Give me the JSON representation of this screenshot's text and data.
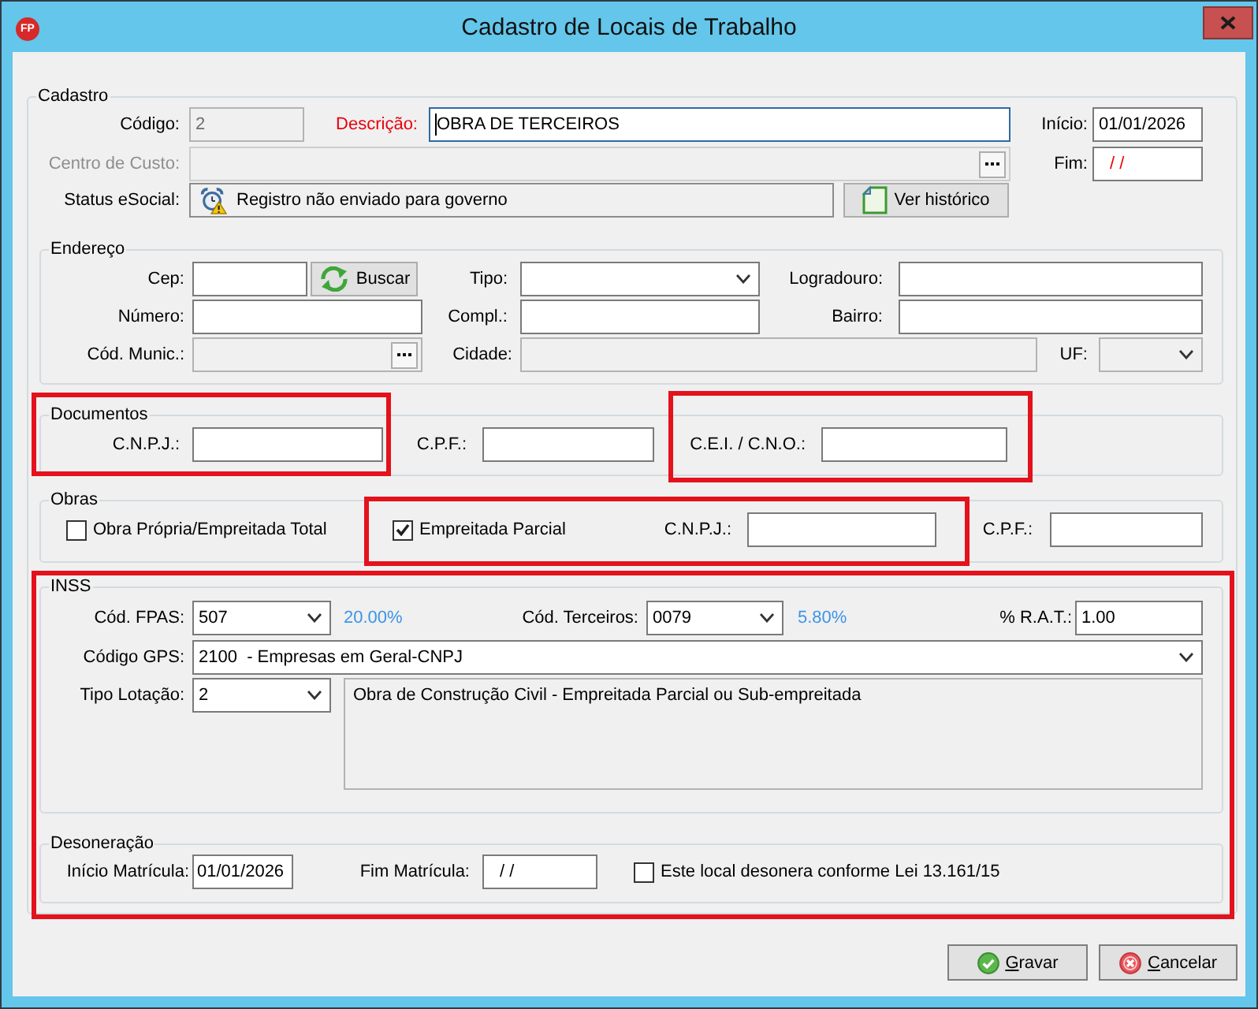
{
  "window": {
    "logo": "FP",
    "title": "Cadastro de Locais de Trabalho"
  },
  "cadastro": {
    "legend": "Cadastro",
    "codigo": {
      "label": "Código:",
      "value": "2",
      "read_only": true
    },
    "descricao": {
      "label": "Descrição:",
      "value": "OBRA DE TERCEIROS",
      "required": true,
      "focused": true
    },
    "inicio": {
      "label": "Início:",
      "value": "01/01/2026"
    },
    "centro_de_custo": {
      "label": "Centro de Custo:",
      "disabled": true
    },
    "fim": {
      "label": "Fim:",
      "value": "/ /",
      "invalid": true
    },
    "status_esocial": {
      "label": "Status eSocial:",
      "value": "Registro não enviado para governo"
    },
    "historico_button": "Ver histórico"
  },
  "endereco": {
    "legend": "Endereço",
    "cep": {
      "label": "Cep:"
    },
    "buscar_button": "Buscar",
    "tipo": {
      "label": "Tipo:"
    },
    "logradouro": {
      "label": "Logradouro:"
    },
    "numero": {
      "label": "Número:"
    },
    "compl": {
      "label": "Compl.:"
    },
    "bairro": {
      "label": "Bairro:"
    },
    "cod_munic": {
      "label": "Cód. Munic.:",
      "read_only": true
    },
    "cidade": {
      "label": "Cidade:",
      "read_only": true
    },
    "uf": {
      "label": "UF:",
      "read_only": true
    }
  },
  "documentos": {
    "legend": "Documentos",
    "cnpj": {
      "label": "C.N.P.J.:"
    },
    "cpf": {
      "label": "C.P.F.:"
    },
    "cei_cno": {
      "label": "C.E.I. / C.N.O.:"
    }
  },
  "obras": {
    "legend": "Obras",
    "options": [
      {
        "label": "Obra Própria/Empreitada Total",
        "checked": false
      },
      {
        "label": "Empreitada Parcial",
        "checked": true
      }
    ],
    "cnpj": {
      "label": "C.N.P.J.:"
    },
    "cpf": {
      "label": "C.P.F.:"
    }
  },
  "inss": {
    "legend": "INSS",
    "cod_fpas": {
      "label": "Cód. FPAS:",
      "value": "507",
      "rate": "20.00%"
    },
    "cod_terceiros": {
      "label": "Cód. Terceiros:",
      "value": "0079",
      "rate": "5.80%"
    },
    "rat": {
      "label": "% R.A.T.:",
      "value": "1.00"
    },
    "codigo_gps": {
      "label": "Código GPS:",
      "value": "2100  - Empresas em Geral-CNPJ"
    },
    "tipo_lotacao": {
      "label": "Tipo Lotação:",
      "value": "2",
      "description": "Obra de Construção Civil - Empreitada Parcial ou Sub-empreitada"
    }
  },
  "desoneracao": {
    "legend": "Desoneração",
    "inicio_matricula": {
      "label": "Início Matrícula:",
      "value": "01/01/2026"
    },
    "fim_matricula": {
      "label": "Fim Matrícula:",
      "value": "/ /"
    },
    "desonera": {
      "label": "Este local desonera conforme Lei 13.161/15",
      "checked": false
    }
  },
  "buttons": [
    {
      "kind": "save",
      "label": "Gravar",
      "underline_initial": true
    },
    {
      "kind": "cancel",
      "label": "Cancelar",
      "underline_initial": true
    }
  ]
}
